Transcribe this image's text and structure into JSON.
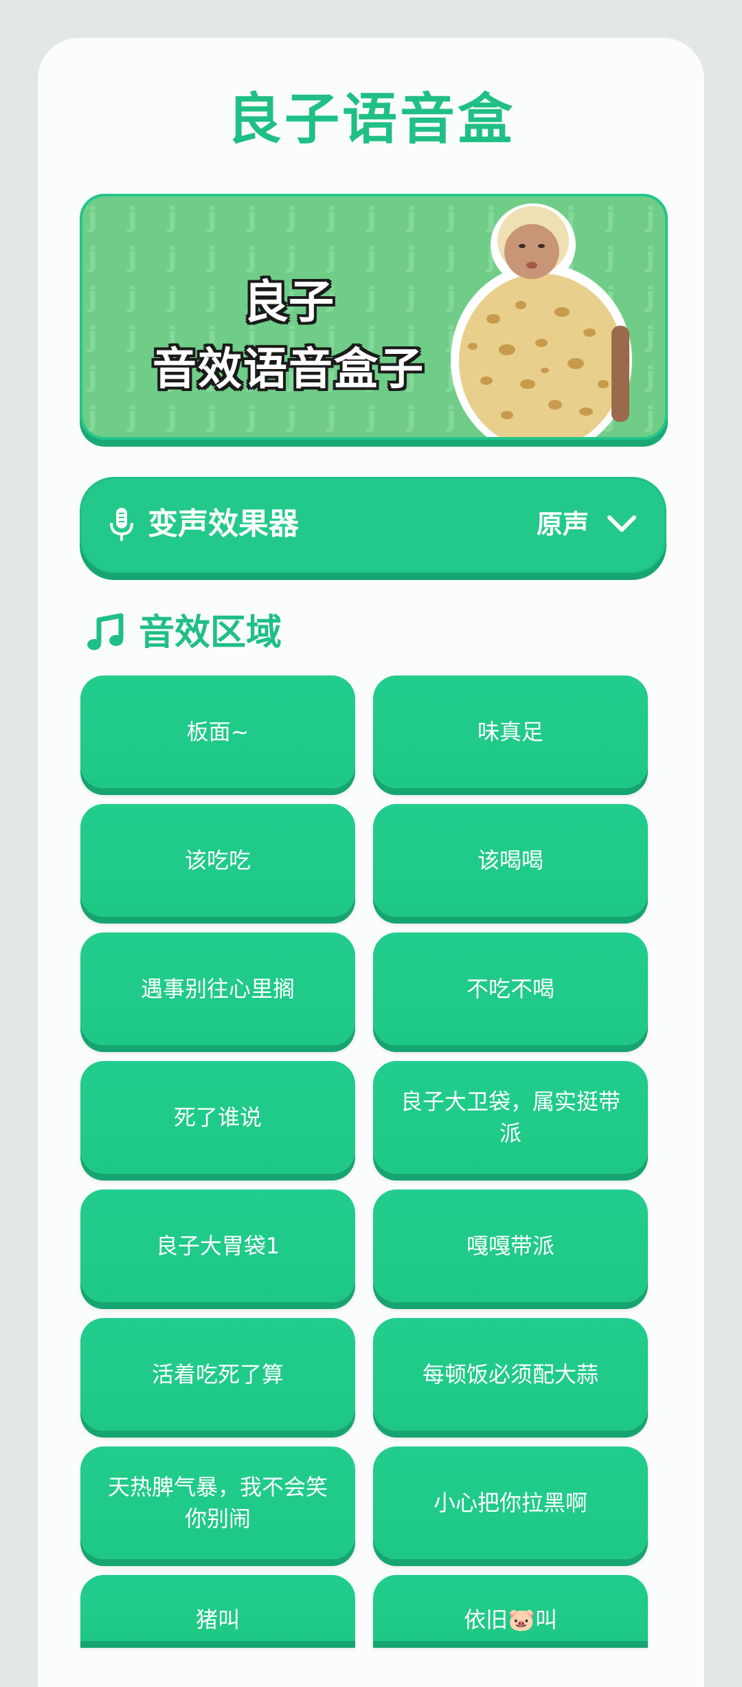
{
  "app": {
    "title": "良子语音盒"
  },
  "banner": {
    "line1": "良子",
    "line2": "音效语音盒子"
  },
  "voice_changer": {
    "icon": "mic-icon",
    "title": "变声效果器",
    "selected": "原声"
  },
  "sound_section": {
    "icon": "music-note-icon",
    "title": "音效区域"
  },
  "sounds": [
    "板面~",
    "味真足",
    "该吃吃",
    "该喝喝",
    "遇事别往心里搁",
    "不吃不喝",
    "死了谁说",
    "良子大卫袋，属实挺带派",
    "良子大胃袋1",
    "嘎嘎带派",
    "活着吃死了算",
    "每顿饭必须配大蒜",
    "天热脾气暴，我不会笑你别闹",
    "小心把你拉黑啊",
    "猪叫",
    "依旧🐷叫"
  ],
  "colors": {
    "accent": "#1fbf85",
    "button": "#22cd8d",
    "button_shadow": "#16a570",
    "banner_bg": "#6fcd88"
  }
}
